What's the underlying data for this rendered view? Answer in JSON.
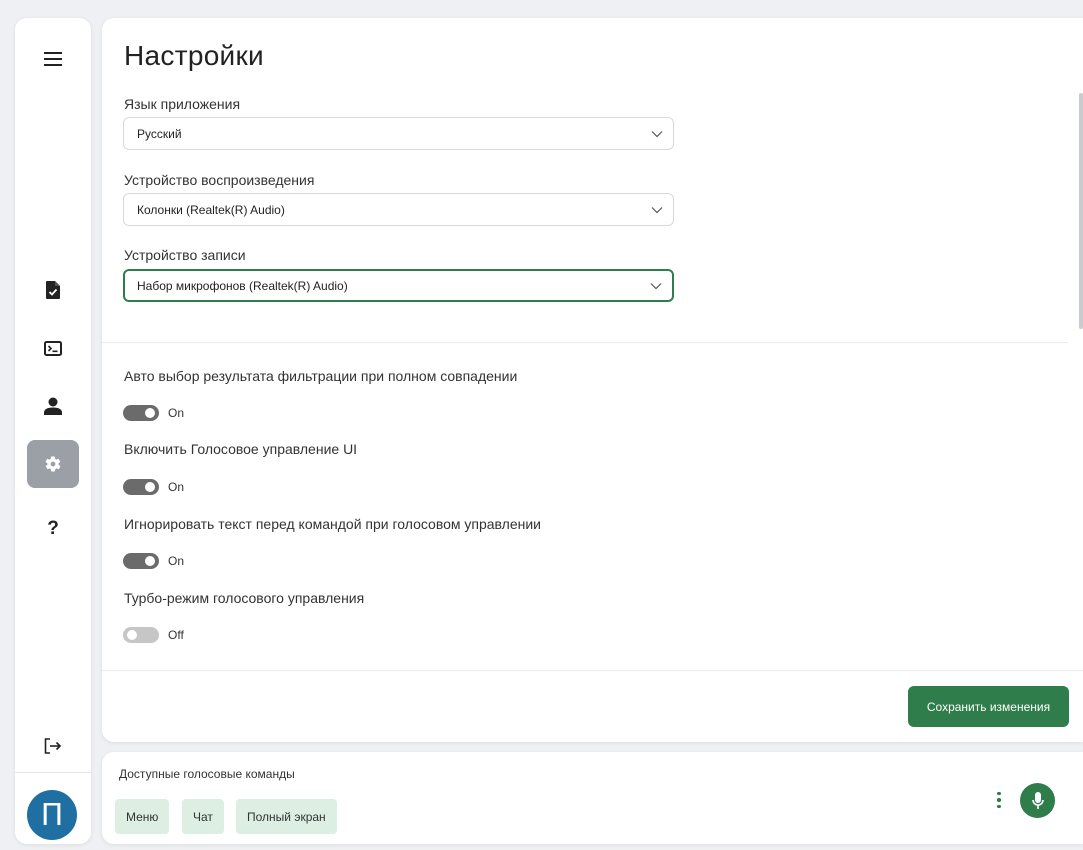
{
  "sidebar": {
    "items": [
      {
        "icon": "menu-icon"
      },
      {
        "icon": "document-check-icon"
      },
      {
        "icon": "terminal-icon"
      },
      {
        "icon": "user-icon"
      },
      {
        "icon": "gear-icon",
        "active": true
      },
      {
        "icon": "help-icon",
        "label": "?"
      },
      {
        "icon": "logout-icon"
      }
    ],
    "avatar_letter": "П"
  },
  "settings": {
    "title": "Настройки",
    "fields": [
      {
        "label": "Язык приложения",
        "value": "Русский"
      },
      {
        "label": "Устройство воспроизведения",
        "value": "Колонки (Realtek(R) Audio)"
      },
      {
        "label": "Устройство записи",
        "value": "Набор микрофонов (Realtek(R) Audio)"
      }
    ],
    "options": [
      {
        "label": "Авто выбор результата фильтрации при полном совпадении",
        "state": "On"
      },
      {
        "label": "Включить Голосовое управление UI",
        "state": "On"
      },
      {
        "label": "Игнорировать текст перед командой при голосовом управлении",
        "state": "On"
      },
      {
        "label": "Турбо-режим голосового управления",
        "state": "Off"
      }
    ],
    "save_label": "Сохранить изменения"
  },
  "voice": {
    "title": "Доступные голосовые команды",
    "commands": [
      "Меню",
      "Чат",
      "Полный экран"
    ]
  },
  "colors": {
    "accent": "#2e7d4a",
    "active_nav": "#9aa0a6",
    "avatar": "#1f6fa3",
    "chip": "#dcefe2"
  }
}
